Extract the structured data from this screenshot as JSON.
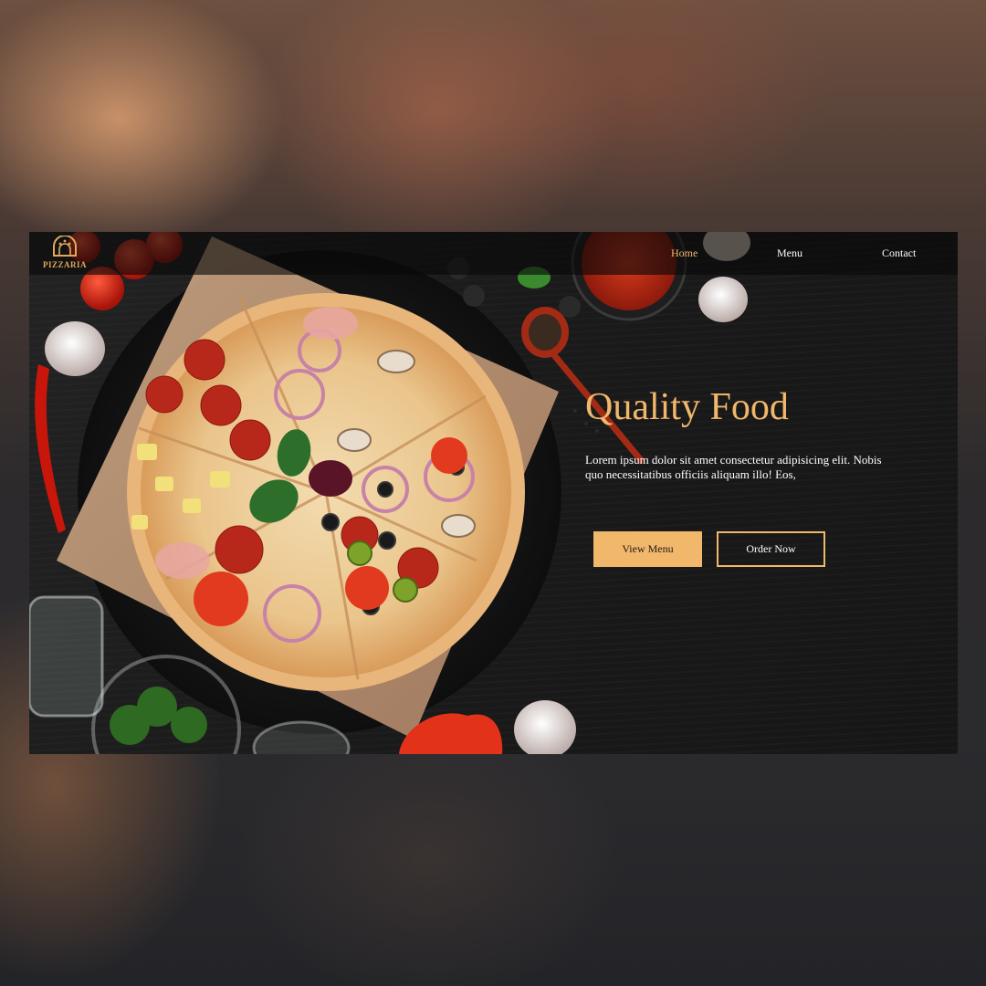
{
  "brand": {
    "logo_text": "PIZZARIA",
    "accent_color": "#f1b76a"
  },
  "nav": {
    "items": [
      {
        "label": "Home",
        "active": true
      },
      {
        "label": "Menu",
        "active": false
      },
      {
        "label": "Contact",
        "active": false
      }
    ]
  },
  "hero": {
    "title": "Quality Food",
    "description": "Lorem ipsum dolor sit amet consectetur adipisicing elit. Nobis quo necessitatibus officiis aliquam illo! Eos,",
    "primary_button": "View Menu",
    "secondary_button": "Order Now"
  },
  "images": {
    "hero_photo": "pizza-with-ingredients-photo"
  }
}
